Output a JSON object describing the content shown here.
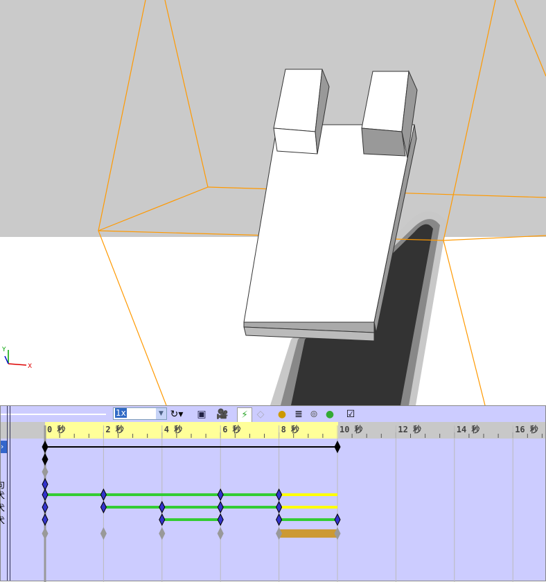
{
  "toolbar": {
    "playback_speed": "1x"
  },
  "timeline": {
    "unit": "秒",
    "ticks": [
      "0 秒",
      "2 秒",
      "4 秒",
      "6 秒",
      "8 秒",
      "10 秒",
      "12 秒",
      "14 秒",
      "16 秒"
    ],
    "tick_seconds": [
      0,
      2,
      4,
      6,
      8,
      10,
      12,
      14,
      16
    ],
    "row_labels": [
      "",
      "",
      "",
      "句",
      "犬",
      "犬",
      "犬",
      ""
    ],
    "rows": [
      {
        "keys": [
          0,
          10
        ],
        "color": "#000000",
        "bars": [
          {
            "from": 0,
            "to": 10,
            "color": "#000000",
            "kind": "line"
          }
        ]
      },
      {
        "keys": [
          0
        ],
        "color": "#000000",
        "bars": []
      },
      {
        "keys": [
          0
        ],
        "color": "#999999",
        "bars": []
      },
      {
        "keys": [
          0
        ],
        "color": "#3333cc",
        "bars": []
      },
      {
        "keys": [
          0,
          2,
          6,
          8
        ],
        "color": "#3333cc",
        "bars": [
          {
            "from": 0,
            "to": 8,
            "color": "#33cc33"
          },
          {
            "from": 8,
            "to": 10,
            "color": "#ffff00"
          }
        ]
      },
      {
        "keys": [
          0,
          2,
          4,
          6,
          8
        ],
        "color": "#3333cc",
        "bars": [
          {
            "from": 2,
            "to": 8,
            "color": "#33cc33"
          },
          {
            "from": 8,
            "to": 10,
            "color": "#ffff00"
          }
        ]
      },
      {
        "keys": [
          0,
          4,
          6,
          8,
          10
        ],
        "color": "#3333cc",
        "bars": [
          {
            "from": 4,
            "to": 6,
            "color": "#33cc33"
          },
          {
            "from": 8,
            "to": 10,
            "color": "#33cc33"
          }
        ]
      },
      {
        "keys": [
          0,
          2,
          4,
          6,
          8,
          10
        ],
        "color": "#999999",
        "bars": [
          {
            "from": 8,
            "to": 10,
            "color": "#cc9933",
            "kind": "thick"
          }
        ]
      }
    ]
  }
}
